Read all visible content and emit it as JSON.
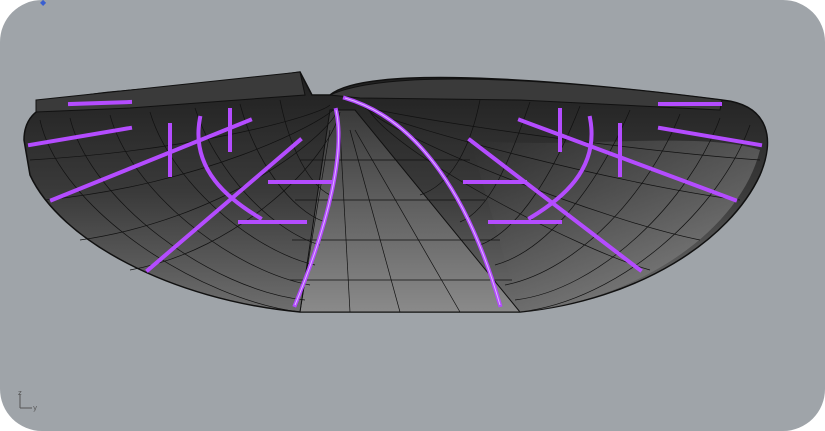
{
  "viewport": {
    "background_color": "#9fa4a9",
    "shell_color_dark": "#2b2b2b",
    "shell_color_light": "#8a8a8a",
    "wire_color": "#111111",
    "highlight_color": "#b44cff",
    "highlight_glow": "#d9a8ff"
  },
  "axis_gizmo": {
    "z_label": "z",
    "y_label": "y"
  }
}
